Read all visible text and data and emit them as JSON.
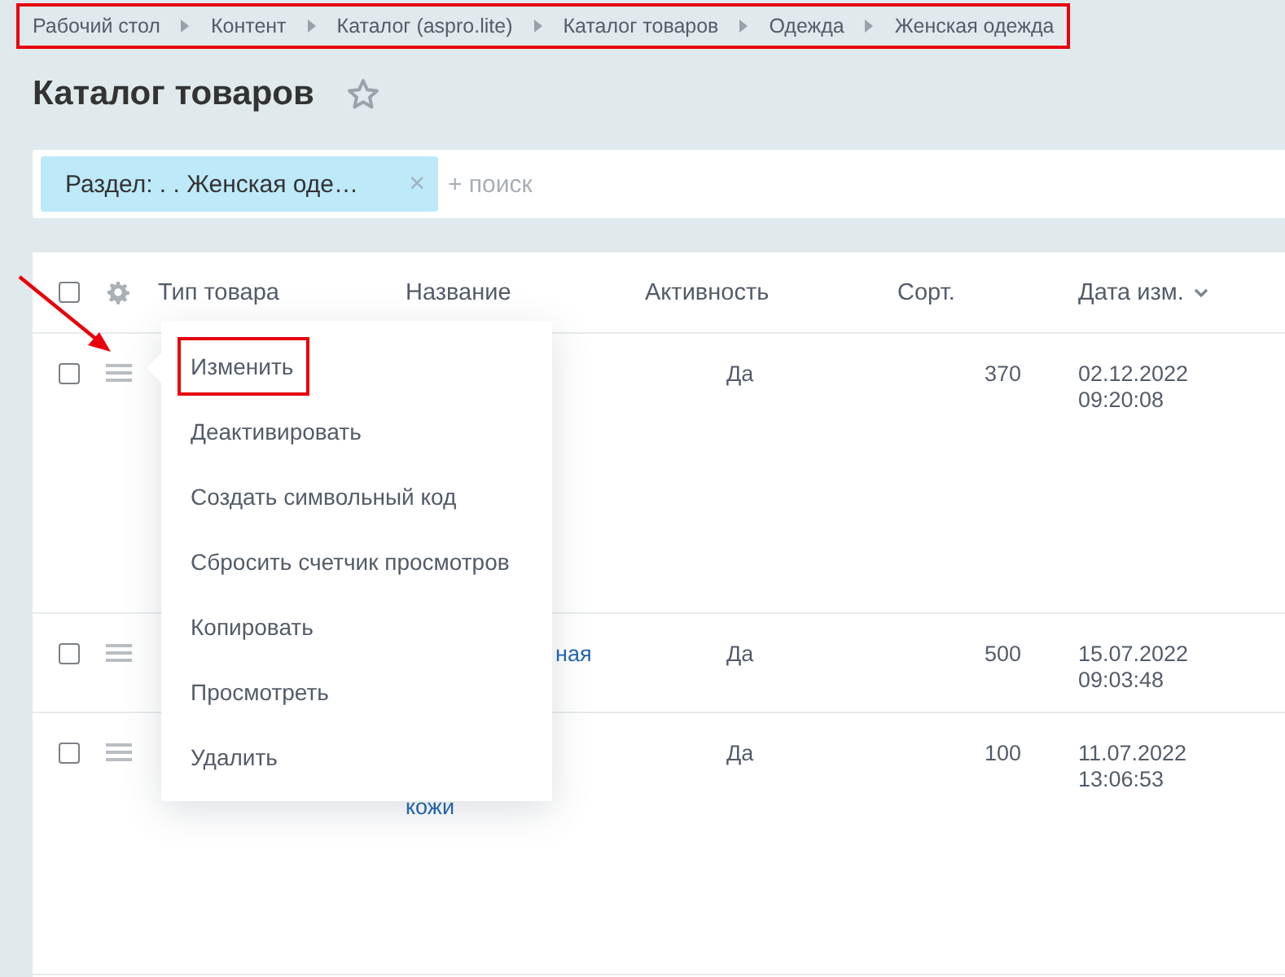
{
  "breadcrumbs": {
    "highlighted": true,
    "items": [
      "Рабочий стол",
      "Контент",
      "Каталог (aspro.lite)",
      "Каталог товаров",
      "Одежда",
      "Женская одежда"
    ]
  },
  "title": "Каталог товаров",
  "filter": {
    "chip": "Раздел: . . Женская оде…",
    "chip_close": "×",
    "placeholder": "+ поиск"
  },
  "table": {
    "header_checked": false,
    "columns": [
      {
        "label": "Тип товара",
        "sorted": false
      },
      {
        "label": "Название",
        "sorted": false
      },
      {
        "label": "Активность",
        "sorted": false
      },
      {
        "label": "Сорт.",
        "sorted": false
      },
      {
        "label": "Дата изм.",
        "sorted": true
      }
    ],
    "rows": [
      {
        "checked": false,
        "kind": "plain",
        "name": "",
        "active": "Да",
        "sort": "370",
        "date": "02.12.2022",
        "time": "09:20:08"
      },
      {
        "checked": false,
        "kind": "tail",
        "name": "ная",
        "active": "Да",
        "sort": "500",
        "date": "15.07.2022",
        "time": "09:03:48"
      },
      {
        "checked": false,
        "kind": "below",
        "name": "кожи",
        "active": "Да",
        "sort": "100",
        "date": "11.07.2022",
        "time": "13:06:53"
      }
    ]
  },
  "context_menu": {
    "items": [
      {
        "label": "Изменить",
        "highlighted": true
      },
      {
        "label": "Деактивировать",
        "highlighted": false
      },
      {
        "label": "Создать символьный код",
        "highlighted": false
      },
      {
        "label": "Сбросить счетчик просмотров",
        "highlighted": false
      },
      {
        "label": "Копировать",
        "highlighted": false
      },
      {
        "label": "Просмотреть",
        "highlighted": false
      },
      {
        "label": "Удалить",
        "highlighted": false
      }
    ]
  }
}
